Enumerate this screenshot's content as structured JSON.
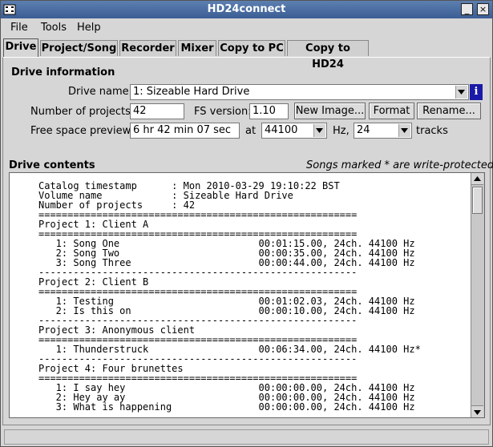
{
  "window": {
    "title": "HD24connect"
  },
  "menu": {
    "items": [
      "File",
      "Tools",
      "Help"
    ]
  },
  "tabs": [
    "Drive",
    "Project/Song",
    "Recorder",
    "Mixer",
    "Copy to PC",
    "Copy to HD24"
  ],
  "drive_info": {
    "heading": "Drive information",
    "drive_name_label": "Drive name:",
    "drive_name_value": "1: Sizeable Hard Drive",
    "num_projects_label": "Number of projects:",
    "num_projects_value": "42",
    "fs_version_label": "FS version:",
    "fs_version_value": "1.10",
    "new_image_label": "New Image...",
    "format_label": "Format",
    "rename_label": "Rename...",
    "free_space_label": "Free space preview:",
    "free_space_value": "6 hr 42 min 07 sec",
    "at_label": "at",
    "rate_value": "44100",
    "hz_label": "Hz,",
    "tracks_value": "24",
    "tracks_label": "tracks",
    "info_icon": "i"
  },
  "drive_contents": {
    "heading": "Drive contents",
    "note": "Songs marked * are write-protected.",
    "catalog": "Catalog timestamp      : Mon 2010-03-29 19:10:22 BST\nVolume name            : Sizeable Hard Drive\nNumber of projects     : 42\n=======================================================\nProject 1: Client A\n=======================================================\n   1: Song One                        00:01:15.00, 24ch. 44100 Hz\n   2: Song Two                        00:00:35.00, 24ch. 44100 Hz\n   3: Song Three                      00:00:44.00, 24ch. 44100 Hz\n-------------------------------------------------------\nProject 2: Client B\n=======================================================\n   1: Testing                         00:01:02.03, 24ch. 44100 Hz\n   2: Is this on                      00:00:10.00, 24ch. 44100 Hz\n-------------------------------------------------------\nProject 3: Anonymous client\n=======================================================\n   1: Thunderstruck                   00:06:34.00, 24ch. 44100 Hz*\n-------------------------------------------------------\nProject 4: Four brunettes\n=======================================================\n   1: I say hey                       00:00:00.00, 24ch. 44100 Hz\n   2: Hey ay ay                       00:00:00.00, 24ch. 44100 Hz\n   3: What is happening               00:00:00.00, 24ch. 44100 Hz"
  }
}
